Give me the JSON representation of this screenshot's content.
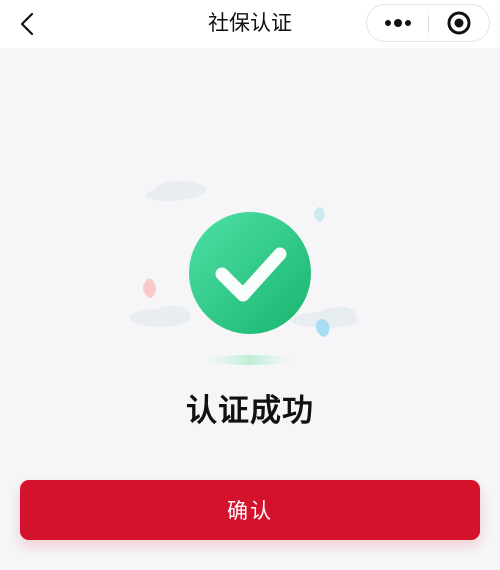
{
  "header": {
    "title": "社保认证",
    "back_icon": "chevron-left-icon",
    "more_icon": "more-dots-icon",
    "close_icon": "target-close-icon"
  },
  "main": {
    "status_icon": "check-circle-icon",
    "status_text": "认证成功"
  },
  "footer": {
    "confirm_label": "确认"
  },
  "colors": {
    "accent": "#d4122b",
    "success_green": "#2fc787",
    "background": "#f6f6f8"
  }
}
